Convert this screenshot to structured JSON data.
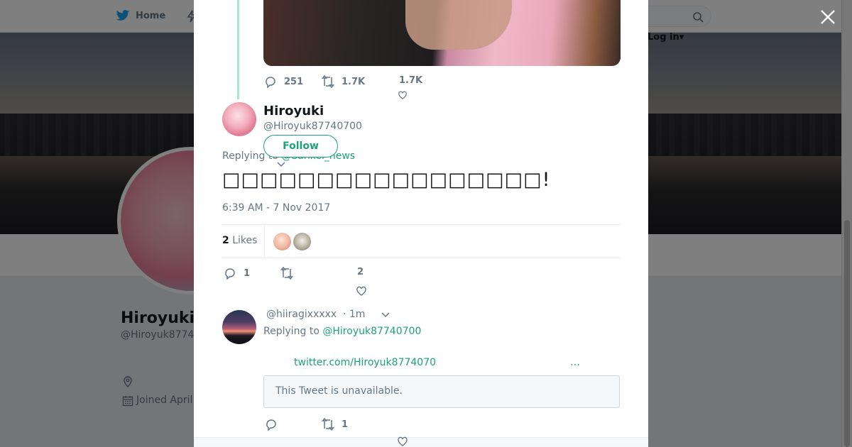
{
  "nav": {
    "home_label": "Home",
    "login_label": "Log in"
  },
  "profile": {
    "name": "Hiroyuki",
    "handle": "@Hiroyuk8774",
    "joined": "Joined April"
  },
  "prev_tweet": {
    "replies": "251",
    "retweets": "1.7K",
    "likes": "1.7K"
  },
  "tweet": {
    "author_name": "Hiroyuki",
    "author_handle": "@Hiroyuk87740700",
    "follow_label": "Follow",
    "replying_prefix": "Replying to",
    "replying_to": "@Sankei_news",
    "text": "□□□□□□□□□□□□□□□□□!",
    "timestamp": "6:39 AM - 7 Nov 2017",
    "likes_count": "2",
    "likes_label": "Likes",
    "reply_count": "1",
    "like_count": "2"
  },
  "reply": {
    "handle": "@hiiragixxxxx",
    "time": "· 1m",
    "replying_prefix": "Replying to",
    "replying_to": "@Hiroyuk87740700",
    "link": "twitter.com/Hiroyuk8774070",
    "ellipsis": "…",
    "unavailable": "This Tweet is unavailable.",
    "retweet_count": "1"
  },
  "colors": {
    "accent": "#1da37a",
    "muted": "#657786",
    "text": "#14171a"
  },
  "icons": [
    "twitter-bird-icon",
    "search-icon",
    "close-icon",
    "reply-icon",
    "retweet-icon",
    "heart-icon",
    "location-icon",
    "calendar-icon",
    "chevron-down-icon"
  ]
}
